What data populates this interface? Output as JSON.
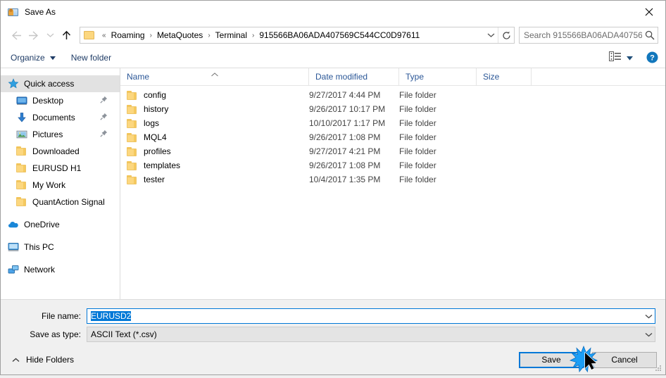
{
  "window": {
    "title": "Save As",
    "icon": "save-as-icon",
    "close_label": "✕"
  },
  "nav": {
    "back": "back-arrow",
    "forward": "forward-arrow",
    "recent": "recent-locations-chevron",
    "up": "up-arrow",
    "breadcrumb_prefix": "«",
    "breadcrumbs": [
      "Roaming",
      "MetaQuotes",
      "Terminal",
      "915566BA06ADA407569C544CC0D97611"
    ],
    "separator": "›",
    "dropdown": "chevron-down-icon",
    "refresh": "refresh-icon"
  },
  "search": {
    "placeholder": "Search 915566BA06ADA40756...",
    "icon": "search-icon"
  },
  "toolbar": {
    "organize_label": "Organize",
    "organize_caret": "▾",
    "new_folder_label": "New folder",
    "view_icon": "view-layout-icon",
    "view_caret": "▾",
    "help_icon": "help-icon",
    "help_glyph": "?"
  },
  "sidebar": {
    "items": [
      {
        "label": "Quick access",
        "icon": "star-icon",
        "selected": true,
        "root": true,
        "pinned": false
      },
      {
        "label": "Desktop",
        "icon": "desktop-icon",
        "selected": false,
        "root": false,
        "pinned": true
      },
      {
        "label": "Documents",
        "icon": "documents-icon",
        "selected": false,
        "root": false,
        "pinned": true
      },
      {
        "label": "Pictures",
        "icon": "pictures-icon",
        "selected": false,
        "root": false,
        "pinned": true
      },
      {
        "label": "Downloaded",
        "icon": "folder-icon",
        "selected": false,
        "root": false,
        "pinned": false
      },
      {
        "label": "EURUSD H1",
        "icon": "folder-icon",
        "selected": false,
        "root": false,
        "pinned": false
      },
      {
        "label": "My Work",
        "icon": "folder-icon",
        "selected": false,
        "root": false,
        "pinned": false
      },
      {
        "label": "QuantAction Signal",
        "icon": "folder-icon",
        "selected": false,
        "root": false,
        "pinned": false
      },
      {
        "label": "OneDrive",
        "icon": "onedrive-icon",
        "selected": false,
        "root": true,
        "pinned": false,
        "gap_before": true
      },
      {
        "label": "This PC",
        "icon": "this-pc-icon",
        "selected": false,
        "root": true,
        "pinned": false,
        "gap_before": true
      },
      {
        "label": "Network",
        "icon": "network-icon",
        "selected": false,
        "root": true,
        "pinned": false,
        "gap_before": true
      }
    ]
  },
  "filelist": {
    "columns": {
      "name": "Name",
      "date_modified": "Date modified",
      "type": "Type",
      "size": "Size"
    },
    "sort_indicator": "▲",
    "rows": [
      {
        "name": "config",
        "date": "9/27/2017 4:44 PM",
        "type": "File folder",
        "size": ""
      },
      {
        "name": "history",
        "date": "9/26/2017 10:17 PM",
        "type": "File folder",
        "size": ""
      },
      {
        "name": "logs",
        "date": "10/10/2017 1:17 PM",
        "type": "File folder",
        "size": ""
      },
      {
        "name": "MQL4",
        "date": "9/26/2017 1:08 PM",
        "type": "File folder",
        "size": ""
      },
      {
        "name": "profiles",
        "date": "9/27/2017 4:21 PM",
        "type": "File folder",
        "size": ""
      },
      {
        "name": "templates",
        "date": "9/26/2017 1:08 PM",
        "type": "File folder",
        "size": ""
      },
      {
        "name": "tester",
        "date": "10/4/2017 1:35 PM",
        "type": "File folder",
        "size": ""
      }
    ]
  },
  "form": {
    "filename_label": "File name:",
    "filename_value": "EURUSD2",
    "savetype_label": "Save as type:",
    "savetype_value": "ASCII Text (*.csv)",
    "combo_arrow": "chevron-down-icon"
  },
  "footer": {
    "hide_folders_label": "Hide Folders",
    "hide_folders_chevron": "▲",
    "save_label": "Save",
    "cancel_label": "Cancel",
    "resize_grip": "resize-grip"
  },
  "colors": {
    "accent": "#0078d7",
    "folder": "#fcd77f",
    "header_text": "#2b5797",
    "selection": "#e2e2e2",
    "dialog_bg": "#f0f0f0"
  }
}
